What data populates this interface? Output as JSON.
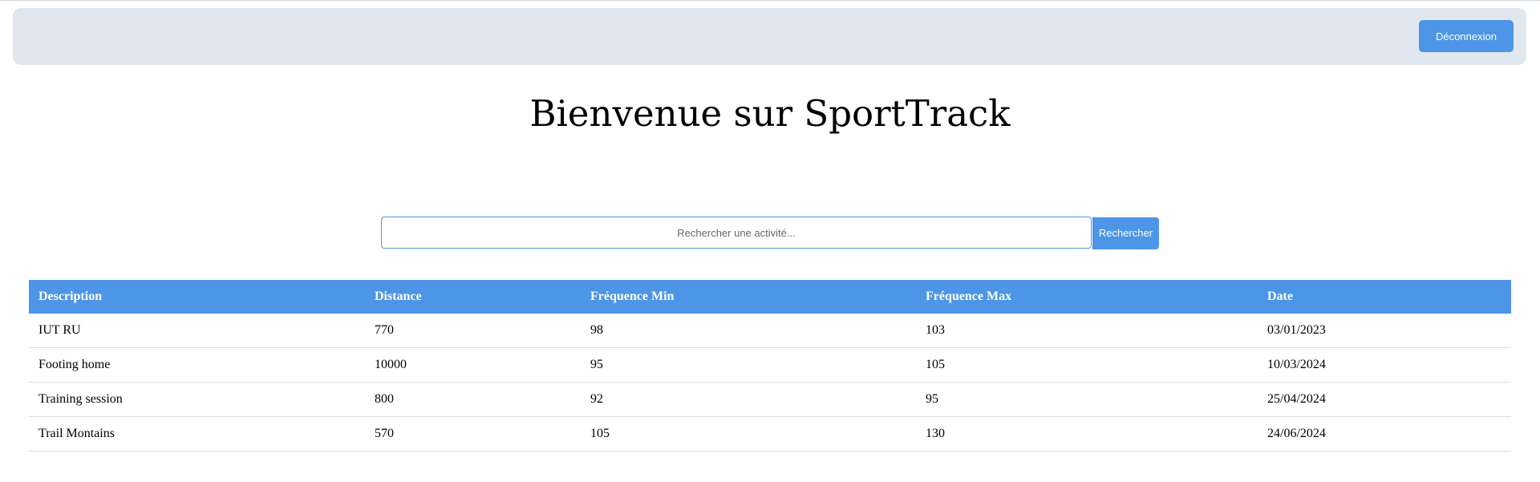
{
  "header": {
    "logout_label": "Déconnexion"
  },
  "page": {
    "title": "Bienvenue sur SportTrack"
  },
  "search": {
    "placeholder": "Rechercher une activité...",
    "value": "",
    "button_label": "Rechercher"
  },
  "table": {
    "columns": [
      "Description",
      "Distance",
      "Fréquence Min",
      "Fréquence Max",
      "Date"
    ],
    "rows": [
      [
        "IUT RU",
        "770",
        "98",
        "103",
        "03/01/2023"
      ],
      [
        "Footing home",
        "10000",
        "95",
        "105",
        "10/03/2024"
      ],
      [
        "Training session",
        "800",
        "92",
        "95",
        "25/04/2024"
      ],
      [
        "Trail Montains",
        "570",
        "105",
        "130",
        "24/06/2024"
      ]
    ]
  },
  "colors": {
    "header_bg": "#e1e7ef",
    "accent": "#4d95e6"
  }
}
